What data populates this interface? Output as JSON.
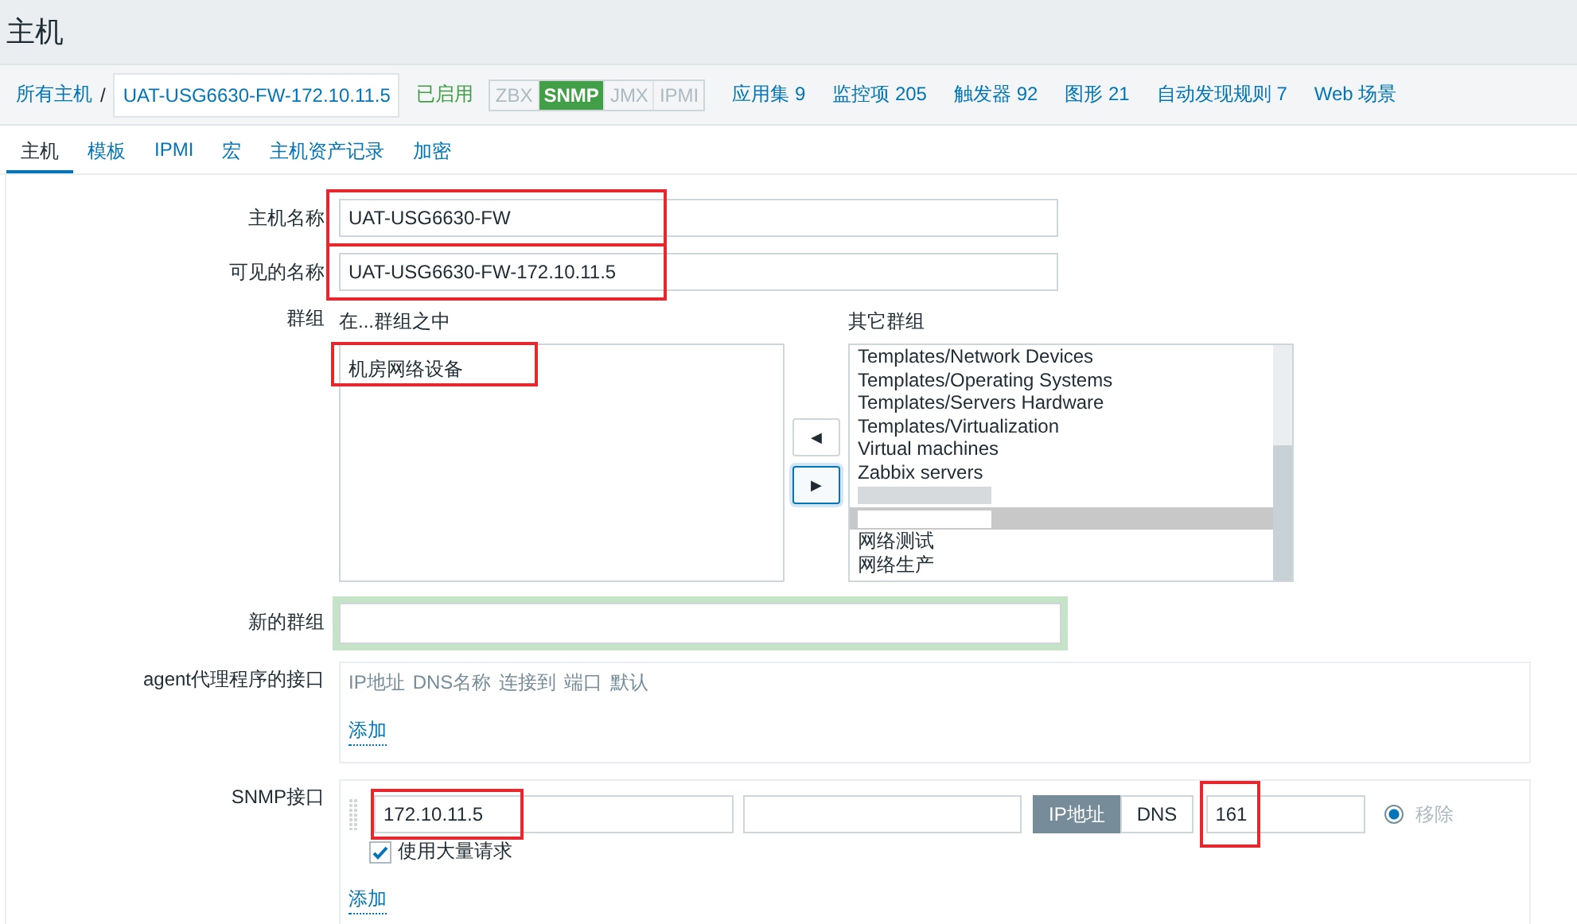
{
  "page_title": "主机",
  "breadcrumb": {
    "root": "所有主机",
    "separator": "/",
    "current": "UAT-USG6630-FW-172.10.11.5",
    "status": "已启用",
    "availability": [
      {
        "label": "ZBX",
        "on": false
      },
      {
        "label": "SNMP",
        "on": true
      },
      {
        "label": "JMX",
        "on": false
      },
      {
        "label": "IPMI",
        "on": false
      }
    ],
    "links": [
      {
        "label": "应用集",
        "count": "9"
      },
      {
        "label": "监控项",
        "count": "205"
      },
      {
        "label": "触发器",
        "count": "92"
      },
      {
        "label": "图形",
        "count": "21"
      },
      {
        "label": "自动发现规则",
        "count": "7"
      },
      {
        "label": "Web 场景"
      }
    ]
  },
  "tabs": [
    {
      "label": "主机",
      "selected": true
    },
    {
      "label": "模板",
      "selected": false
    },
    {
      "label": "IPMI",
      "selected": false
    },
    {
      "label": "宏",
      "selected": false
    },
    {
      "label": "主机资产记录",
      "selected": false
    },
    {
      "label": "加密",
      "selected": false
    }
  ],
  "form": {
    "host_name": {
      "label": "主机名称",
      "value": "UAT-USG6630-FW",
      "highlighted": true
    },
    "visible_name": {
      "label": "可见的名称",
      "value": "UAT-USG6630-FW-172.10.11.5",
      "highlighted": true
    },
    "groups": {
      "label": "群组",
      "in_label": "在...群组之中",
      "other_label": "其它群组",
      "in_groups": [
        {
          "text": "机房网络设备",
          "highlighted": true
        }
      ],
      "move_left": "◀",
      "move_right": "▶",
      "other_groups": [
        {
          "kind": "text",
          "text": "Templates/Network Devices",
          "selected": false
        },
        {
          "kind": "text",
          "text": "Templates/Operating Systems",
          "selected": false
        },
        {
          "kind": "text",
          "text": "Templates/Servers Hardware",
          "selected": false
        },
        {
          "kind": "text",
          "text": "Templates/Virtualization",
          "selected": false
        },
        {
          "kind": "text",
          "text": "Virtual machines",
          "selected": false
        },
        {
          "kind": "text",
          "text": "Zabbix servers",
          "selected": false
        },
        {
          "kind": "redacted",
          "selected": false
        },
        {
          "kind": "redacted",
          "selected": true
        },
        {
          "kind": "text",
          "text": "网络测试",
          "selected": false
        },
        {
          "kind": "text",
          "text": "网络生产",
          "selected": false
        }
      ]
    },
    "new_group": {
      "label": "新的群组"
    },
    "agent": {
      "label": "agent代理程序的接口",
      "columns": [
        "IP地址",
        "DNS名称",
        "连接到",
        "端口",
        "默认"
      ],
      "add": "添加"
    },
    "snmp": {
      "label": "SNMP接口",
      "ip": {
        "value": "172.10.11.5",
        "highlighted": true
      },
      "connect": [
        {
          "label": "IP地址",
          "selected": true
        },
        {
          "label": "DNS",
          "selected": false
        }
      ],
      "port": {
        "value": "161",
        "highlighted": true
      },
      "default": true,
      "remove": "移除",
      "bulk": {
        "label": "使用大量请求",
        "checked": true
      },
      "add": "添加"
    }
  }
}
